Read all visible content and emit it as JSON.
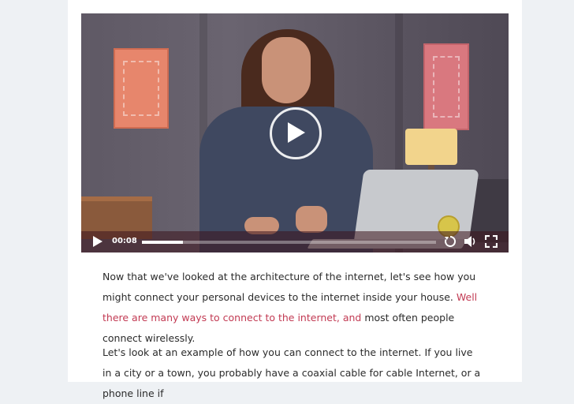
{
  "video": {
    "time_display": "00:08",
    "progress": 0.14,
    "apple_logo_char": "",
    "icons": {
      "play_big": "play-icon",
      "play_small": "play-icon",
      "rewind": "rewind-icon",
      "volume": "volume-icon",
      "fullscreen": "fullscreen-icon",
      "sticker": "sticker-icon"
    }
  },
  "article": {
    "p1_text_a": "Now that we've looked at the architecture of the internet, let's see how you might connect your personal devices to the internet inside your house.",
    "p1_highlight": "Well there are many ways to connect to the internet, and",
    "p1_text_b": "most often people connect wirelessly.",
    "p2_text": "Let's look at an example of how you can connect to the internet. If you live in a city or a town, you probably have a coaxial cable for cable Internet, or a phone line if"
  },
  "colors": {
    "page_bg": "#eef1f4",
    "card_bg": "#ffffff",
    "link": "#c23a53",
    "body_text": "#2b2b2b"
  }
}
